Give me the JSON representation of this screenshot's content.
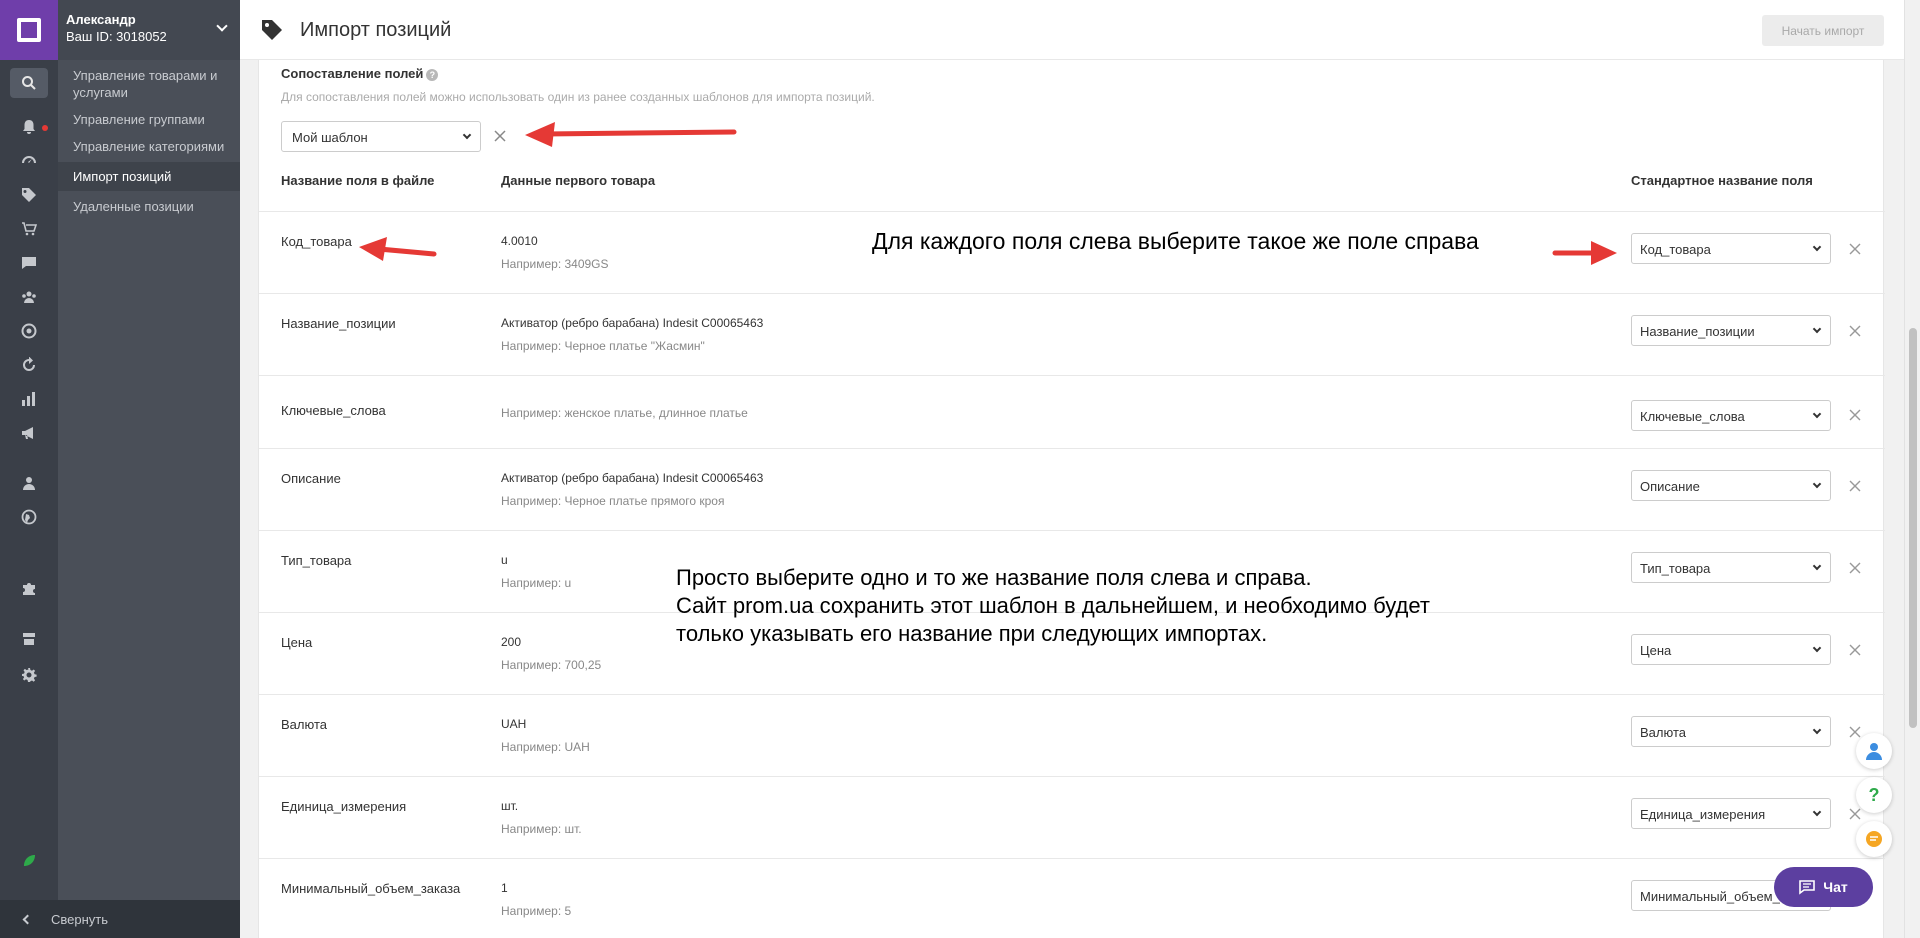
{
  "user": {
    "name": "Александр",
    "id_label": "Ваш ID: 3018052"
  },
  "sidebar": {
    "items": [
      {
        "label": "Управление товарами и услугами"
      },
      {
        "label": "Управление группами"
      },
      {
        "label": "Управление категориями"
      },
      {
        "label": "Импорт позиций"
      },
      {
        "label": "Удаленные позиции"
      }
    ],
    "collapse_label": "Свернуть"
  },
  "rail_icons": [
    "search-icon",
    "bell-icon",
    "gauge-icon",
    "tag-icon",
    "cart-icon",
    "message-icon",
    "users-icon",
    "target-icon",
    "refresh-icon",
    "bar-chart-icon",
    "megaphone-icon",
    "person-icon",
    "globe-icon",
    "puzzle-icon",
    "store-icon",
    "gear-icon",
    "leaf-icon"
  ],
  "header": {
    "title": "Импорт позиций",
    "start_button": "Начать импорт"
  },
  "mapping": {
    "title": "Сопоставление полей",
    "hint": "Для сопоставления полей можно использовать один из ранее созданных шаблонов для импорта позиций.",
    "template_value": "Мой шаблон",
    "columns": {
      "file_field": "Название поля в файле",
      "first_item": "Данные первого товара",
      "standard": "Стандартное название поля"
    },
    "rows": [
      {
        "name": "Код_товара",
        "value": "4.0010",
        "example": "Например: 3409GS",
        "selected": "Код_товара"
      },
      {
        "name": "Название_позиции",
        "value": "Активатор (ребро барабана) Indesit C00065463",
        "example": "Например: Черное платье \"Жасмин\"",
        "selected": "Название_позиции"
      },
      {
        "name": "Ключевые_слова",
        "value": "",
        "example": "Например: женское платье, длинное платье",
        "selected": "Ключевые_слова"
      },
      {
        "name": "Описание",
        "value": "Активатор (ребро барабана) Indesit C00065463",
        "example": "Например: Черное платье прямого кроя",
        "selected": "Описание"
      },
      {
        "name": "Тип_товара",
        "value": "u",
        "example": "Например: u",
        "selected": "Тип_товара"
      },
      {
        "name": "Цена",
        "value": "200",
        "example": "Например: 700,25",
        "selected": "Цена"
      },
      {
        "name": "Валюта",
        "value": "UAH",
        "example": "Например: UAH",
        "selected": "Валюта"
      },
      {
        "name": "Единица_измерения",
        "value": "шт.",
        "example": "Например: шт.",
        "selected": "Единица_измерения"
      },
      {
        "name": "Минимальный_объем_заказа",
        "value": "1",
        "example": "Например: 5",
        "selected": "Минимальный_объем_заказа"
      }
    ]
  },
  "annotations": {
    "top": "Для каждого поля слева выберите такое же поле справа",
    "middle_line1": "Просто выберите одно и то же название поля слева и справа.",
    "middle_line2": "Сайт prom.ua сохранить этот шаблон в дальнейшем, и необходимо будет",
    "middle_line3": "только указывать его название при следующих импортах."
  },
  "chat": {
    "label": "Чат"
  },
  "colors": {
    "brand": "#6f3eaa",
    "chat": "#5c3fa0",
    "arrow": "#e53935"
  }
}
